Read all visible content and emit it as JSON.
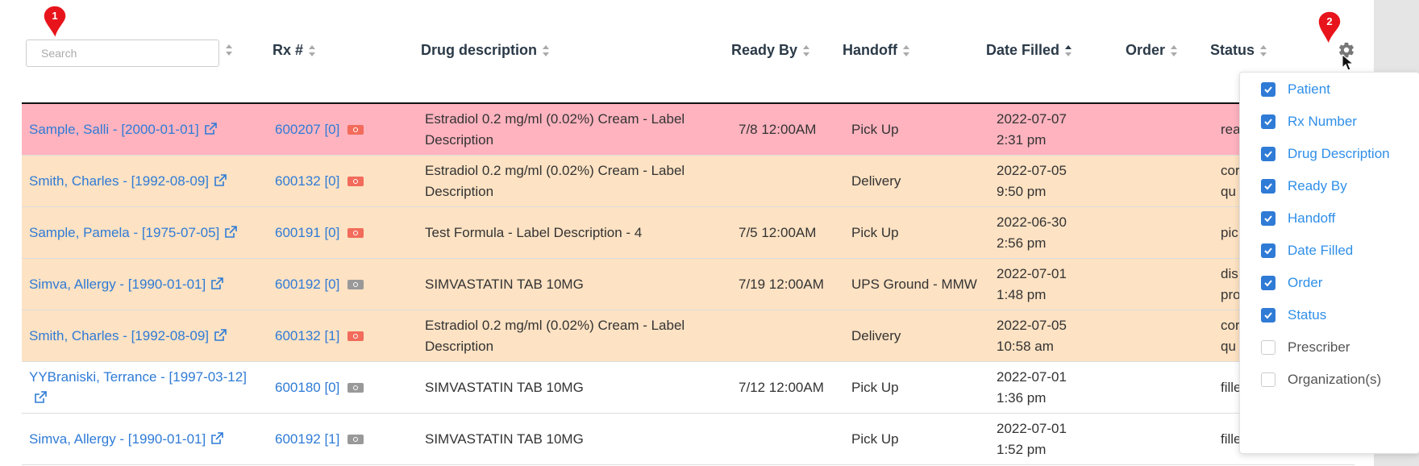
{
  "search": {
    "placeholder": "Search"
  },
  "columns": [
    {
      "label": "Rx #"
    },
    {
      "label": "Drug description"
    },
    {
      "label": "Ready By"
    },
    {
      "label": "Handoff"
    },
    {
      "label": "Date Filled"
    },
    {
      "label": "Order"
    },
    {
      "label": "Status"
    }
  ],
  "rows": [
    {
      "patient": "Sample, Salli -  [2000-01-01]",
      "rx": "600207 [0]",
      "drug": "Estradiol 0.2 mg/ml (0.02%) Cream - Label Description",
      "ready_by": "7/8 12:00AM",
      "handoff": "Pick Up",
      "date": "2022-07-07",
      "time": "2:31 pm",
      "status": "rea",
      "status2": "",
      "highlight": "red",
      "bill": "red"
    },
    {
      "patient": "Smith, Charles -  [1992-08-09]",
      "rx": "600132 [0]",
      "drug": "Estradiol 0.2 mg/ml (0.02%) Cream - Label Description",
      "ready_by": "",
      "handoff": "Delivery",
      "date": "2022-07-05",
      "time": "9:50 pm",
      "status": "cor",
      "status2": "qu",
      "highlight": "orange",
      "bill": "red"
    },
    {
      "patient": "Sample, Pamela -  [1975-07-05]",
      "rx": "600191 [0]",
      "drug": "Test Formula - Label Description - 4",
      "ready_by": "7/5 12:00AM",
      "handoff": "Pick Up",
      "date": "2022-06-30",
      "time": "2:56 pm",
      "status": "pic",
      "status2": "",
      "highlight": "orange",
      "bill": "red"
    },
    {
      "patient": "Simva, Allergy -  [1990-01-01]",
      "rx": "600192 [0]",
      "drug": "SIMVASTATIN TAB 10MG",
      "ready_by": "7/19 12:00AM",
      "handoff": "UPS Ground - MMW",
      "date": "2022-07-01",
      "time": "1:48 pm",
      "status": "dis",
      "status2": "pro",
      "highlight": "orange",
      "bill": "gray"
    },
    {
      "patient": "Smith, Charles -  [1992-08-09]",
      "rx": "600132 [1]",
      "drug": "Estradiol 0.2 mg/ml (0.02%) Cream - Label Description",
      "ready_by": "",
      "handoff": "Delivery",
      "date": "2022-07-05",
      "time": "10:58 am",
      "status": "cor",
      "status2": "qu",
      "highlight": "orange",
      "bill": "red"
    },
    {
      "patient": "YYBraniski, Terrance -  [1997-03-12]",
      "rx": "600180 [0]",
      "drug": "SIMVASTATIN TAB 10MG",
      "ready_by": "7/12 12:00AM",
      "handoff": "Pick Up",
      "date": "2022-07-01",
      "time": "1:36 pm",
      "status": "fille",
      "status2": "",
      "highlight": "white",
      "bill": "gray"
    },
    {
      "patient": "Simva, Allergy -  [1990-01-01]",
      "rx": "600192 [1]",
      "drug": "SIMVASTATIN TAB 10MG",
      "ready_by": "",
      "handoff": "Pick Up",
      "date": "2022-07-01",
      "time": "1:52 pm",
      "status": "fille",
      "status2": "",
      "highlight": "white",
      "bill": "gray"
    }
  ],
  "column_menu": [
    {
      "label": "Patient",
      "checked": true
    },
    {
      "label": "Rx Number",
      "checked": true
    },
    {
      "label": "Drug Description",
      "checked": true
    },
    {
      "label": "Ready By",
      "checked": true
    },
    {
      "label": "Handoff",
      "checked": true
    },
    {
      "label": "Date Filled",
      "checked": true
    },
    {
      "label": "Order",
      "checked": true
    },
    {
      "label": "Status",
      "checked": true
    },
    {
      "label": "Prescriber",
      "checked": false
    },
    {
      "label": "Organization(s)",
      "checked": false
    }
  ],
  "markers": [
    {
      "label": "1"
    },
    {
      "label": "2"
    }
  ],
  "colors": {
    "link": "#2f7bd6",
    "row_red": "#ffb3bf",
    "row_orange": "#fde2c3",
    "marker": "#e8141b",
    "checkbox": "#2f7bd6"
  }
}
